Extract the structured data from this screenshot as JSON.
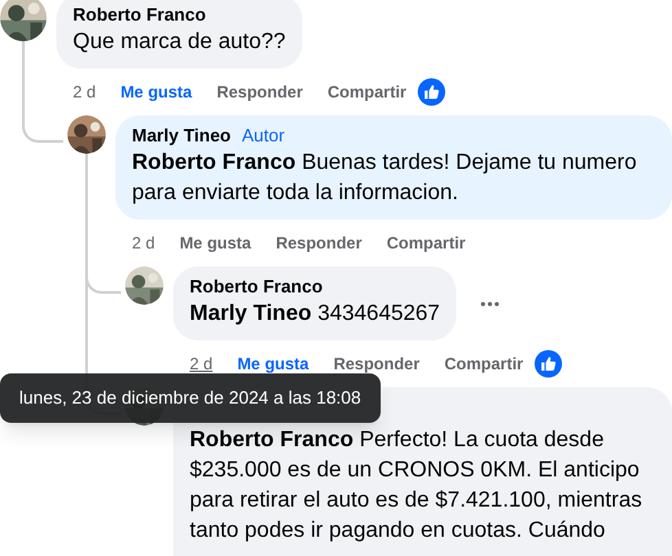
{
  "comments": [
    {
      "author": "Roberto Franco",
      "text": "Que marca de auto??",
      "time": "2 d",
      "time_hovered": false,
      "like_label": "Me gusta",
      "liked": true,
      "reply_label": "Responder",
      "share_label": "Compartir",
      "has_reaction": true,
      "show_options": false,
      "children": [
        {
          "author": "Marly Tineo",
          "badge": "Autor",
          "text": "**Roberto Franco** Buenas tardes! Dejame tu numero para enviarte toda la informacion.",
          "time": "2 d",
          "time_hovered": false,
          "like_label": "Me gusta",
          "liked": false,
          "reply_label": "Responder",
          "share_label": "Compartir",
          "has_reaction": false,
          "show_options": false,
          "children": [
            {
              "author": "Roberto Franco",
              "text": "**Marly Tineo** 3434645267",
              "time": "2 d",
              "time_hovered": true,
              "like_label": "Me gusta",
              "liked": true,
              "reply_label": "Responder",
              "share_label": "Compartir",
              "has_reaction": true,
              "show_options": true
            },
            {
              "text": "**Roberto Franco** Perfecto! La cuota desde $235.000 es de un CRONOS 0KM. El anticipo para retirar el auto es de $7.421.100, mientras tanto podes ir pagando en cuotas. Cuándo",
              "show_options": false
            }
          ]
        }
      ]
    }
  ],
  "tooltip": {
    "text": "lunes, 23 de diciembre de 2024 a las 18:08"
  }
}
